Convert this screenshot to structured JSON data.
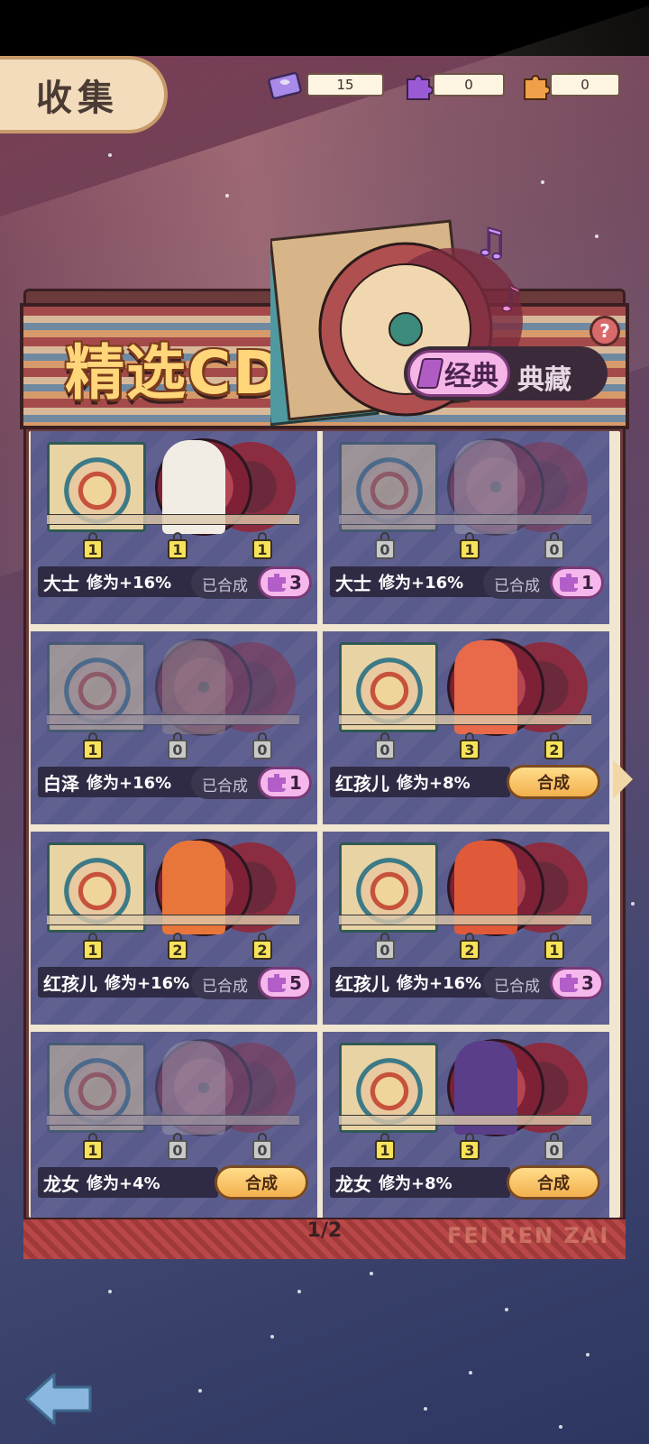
{
  "header": {
    "title": "收集"
  },
  "currencies": [
    {
      "name": "ticket",
      "icon": "ticket-icon",
      "value": "15",
      "color": "#9b7be0"
    },
    {
      "name": "purple-puzzle",
      "icon": "purple-puzzle-icon",
      "value": "0",
      "color": "#9a5ad6"
    },
    {
      "name": "orange-puzzle",
      "icon": "orange-puzzle-icon",
      "value": "0",
      "color": "#f0a048"
    }
  ],
  "panel": {
    "title": "精选CD",
    "tabs": [
      {
        "label": "经典",
        "active": true
      },
      {
        "label": "典藏",
        "active": false
      }
    ],
    "help": "?"
  },
  "cards": [
    {
      "name": "大士",
      "bonus": "修为+16%",
      "counts": [
        "1",
        "1",
        "1"
      ],
      "owned": [
        true,
        true,
        true
      ],
      "merged_label": "已合成",
      "pieces": "3",
      "action": "merged",
      "faded": false,
      "fig_color": "#f1ede4"
    },
    {
      "name": "大士",
      "bonus": "修为+16%",
      "counts": [
        "0",
        "1",
        "0"
      ],
      "owned": [
        false,
        true,
        false
      ],
      "merged_label": "已合成",
      "pieces": "1",
      "action": "merged",
      "faded": true,
      "fig_color": "#f3ead8"
    },
    {
      "name": "白泽",
      "bonus": "修为+16%",
      "counts": [
        "1",
        "0",
        "0"
      ],
      "owned": [
        true,
        false,
        false
      ],
      "merged_label": "已合成",
      "pieces": "1",
      "action": "merged",
      "faded": true,
      "fig_color": "#d9b98a"
    },
    {
      "name": "红孩儿",
      "bonus": "修为+8%",
      "counts": [
        "0",
        "3",
        "2"
      ],
      "owned": [
        false,
        true,
        true
      ],
      "synth_label": "合成",
      "action": "synth",
      "faded": false,
      "fig_color": "#e86a4a"
    },
    {
      "name": "红孩儿",
      "bonus": "修为+16%",
      "counts": [
        "1",
        "2",
        "2"
      ],
      "owned": [
        true,
        true,
        true
      ],
      "merged_label": "已合成",
      "pieces": "5",
      "action": "merged",
      "faded": false,
      "fig_color": "#e8763a"
    },
    {
      "name": "红孩儿",
      "bonus": "修为+16%",
      "counts": [
        "0",
        "2",
        "1"
      ],
      "owned": [
        false,
        true,
        true
      ],
      "merged_label": "已合成",
      "pieces": "3",
      "action": "merged",
      "faded": false,
      "fig_color": "#e05a3a"
    },
    {
      "name": "龙女",
      "bonus": "修为+4%",
      "counts": [
        "1",
        "0",
        "0"
      ],
      "owned": [
        true,
        false,
        false
      ],
      "synth_label": "合成",
      "action": "synth",
      "faded": true,
      "fig_color": "#efe2d2"
    },
    {
      "name": "龙女",
      "bonus": "修为+8%",
      "counts": [
        "1",
        "3",
        "0"
      ],
      "owned": [
        true,
        true,
        false
      ],
      "synth_label": "合成",
      "action": "synth",
      "faded": false,
      "fig_color": "#5a3e8a"
    }
  ],
  "footer": {
    "page": "1/2",
    "watermark": "FEI REN ZAI"
  }
}
